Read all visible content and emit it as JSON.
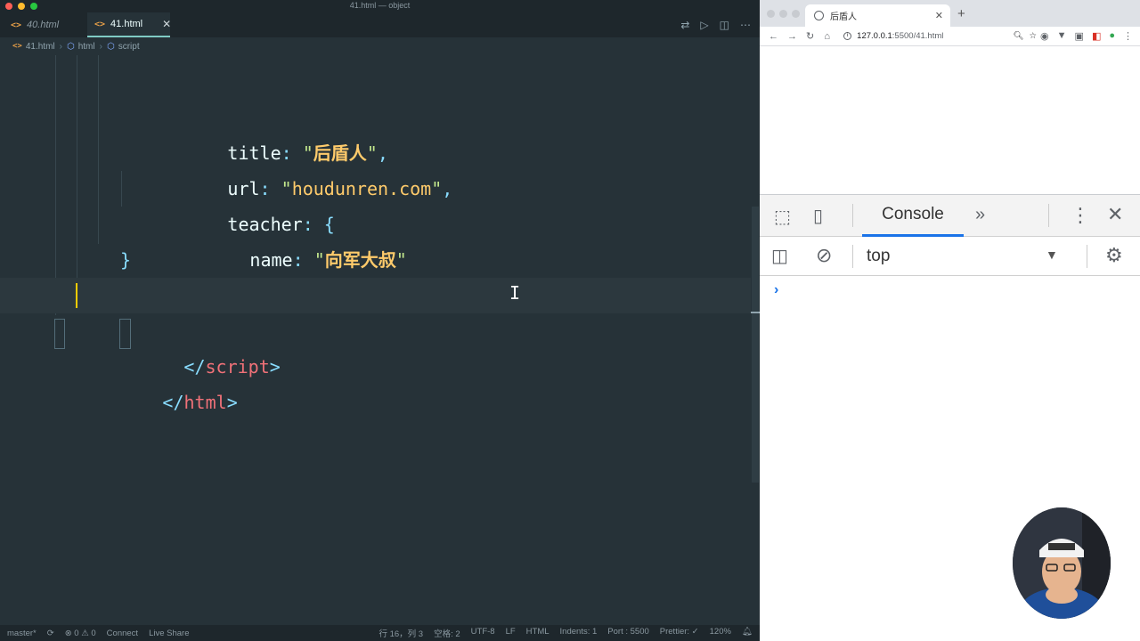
{
  "window": {
    "title": "41.html — object"
  },
  "editor": {
    "tabs": [
      {
        "label": "40.html",
        "active": false
      },
      {
        "label": "41.html",
        "active": true
      }
    ],
    "breadcrumb": [
      "41.html",
      "html",
      "script"
    ],
    "code": {
      "l1_key": "title",
      "l1_val": "后盾人",
      "l2_key": "url",
      "l2_val": "houdunren.com",
      "l3_key": "teacher",
      "l4_key": "name",
      "l4_val": "向军大叔",
      "l5": "}",
      "l6": "};",
      "l7_tag": "script",
      "l8_tag": "html"
    },
    "status": {
      "branch": "master*",
      "problems": "⊗ 0 ⚠ 0",
      "connect": "Connect",
      "liveshare": "Live Share",
      "position": "行 16，列 3",
      "spaces": "空格: 2",
      "encoding": "UTF-8",
      "eol": "LF",
      "language": "HTML",
      "indents": "Indents: 1",
      "port": "Port : 5500",
      "prettier": "Prettier: ✓",
      "zoom": "120%"
    }
  },
  "browser": {
    "tab_title": "后盾人",
    "url_host": "127.0.0.1",
    "url_rest": ":5500/41.html",
    "devtools": {
      "active_tab": "Console",
      "context": "top",
      "prompt": "›"
    }
  }
}
